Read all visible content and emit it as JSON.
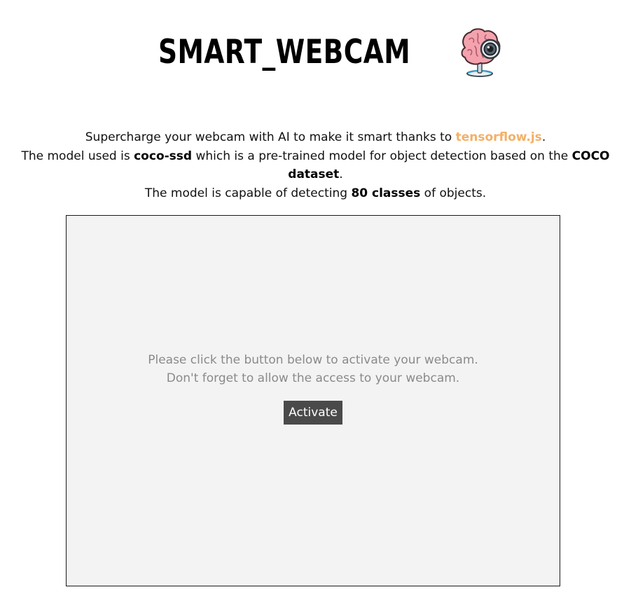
{
  "header": {
    "title": "SMART_WEBCAM",
    "logo_icon": "brain-webcam-icon"
  },
  "intro": {
    "line1_pre": "Supercharge your webcam with AI to make it smart thanks to ",
    "line1_link": "tensorflow.js",
    "line1_post": ".",
    "line2_pre": "The model used is ",
    "line2_model": "coco-ssd",
    "line2_mid": " which is a pre-trained model for object detection based on the ",
    "line2_dataset": "COCO dataset",
    "line2_post": ".",
    "line3_pre": "The model is capable of detecting ",
    "line3_classes": "80 classes",
    "line3_post": " of objects."
  },
  "webcam": {
    "message_line1": "Please click the button below to activate your webcam.",
    "message_line2": "Don't forget to allow the access to your webcam.",
    "activate_label": "Activate"
  },
  "colors": {
    "link": "#f3b066",
    "panel_bg": "#f3f3f3",
    "button_bg": "#4a4a4a",
    "message_text": "#8a8a8a"
  }
}
